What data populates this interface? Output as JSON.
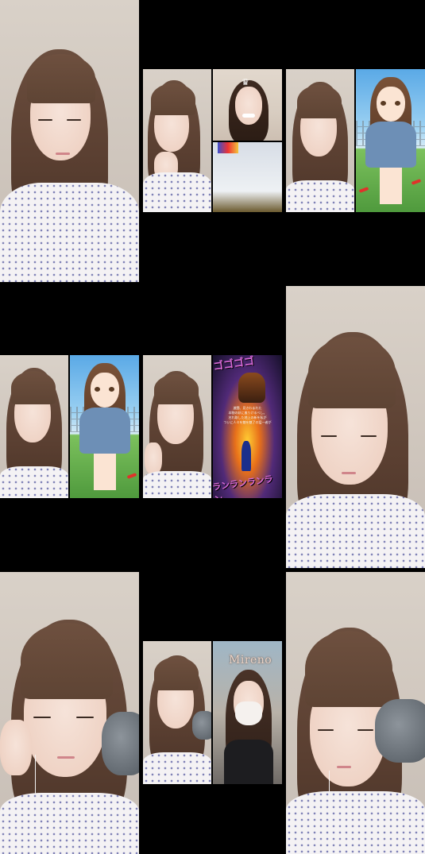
{
  "tiles": [
    {
      "id": "tile-1",
      "kind": "single"
    },
    {
      "id": "tile-2",
      "kind": "split-collab"
    },
    {
      "id": "tile-3",
      "kind": "split-manga"
    },
    {
      "id": "tile-4",
      "kind": "split-manga"
    },
    {
      "id": "tile-5",
      "kind": "split-jojo"
    },
    {
      "id": "tile-6",
      "kind": "single"
    },
    {
      "id": "tile-7",
      "kind": "single-mic"
    },
    {
      "id": "tile-8",
      "kind": "split-collab-mask"
    },
    {
      "id": "tile-9",
      "kind": "single-mic"
    }
  ],
  "overlays": {
    "tile8_name": "Mireno",
    "jojo_caption_line1": "激闘、見きわまれた",
    "jojo_caption_line2": "本物の妖に嵐りけるべし。",
    "jojo_caption_line3": "名れ取した地上の新を私が",
    "jojo_caption_line4": "ついに人々を魅を魅了の猛一者が",
    "jojo_kana_top": "ゴゴゴゴ",
    "jojo_kana_bottom": "ランランランラン"
  },
  "colors": {
    "background": "#000000",
    "hair": "#5e4434",
    "shirt_dot": "#7d7fb5",
    "manga_sky": "#5aa9e6"
  }
}
